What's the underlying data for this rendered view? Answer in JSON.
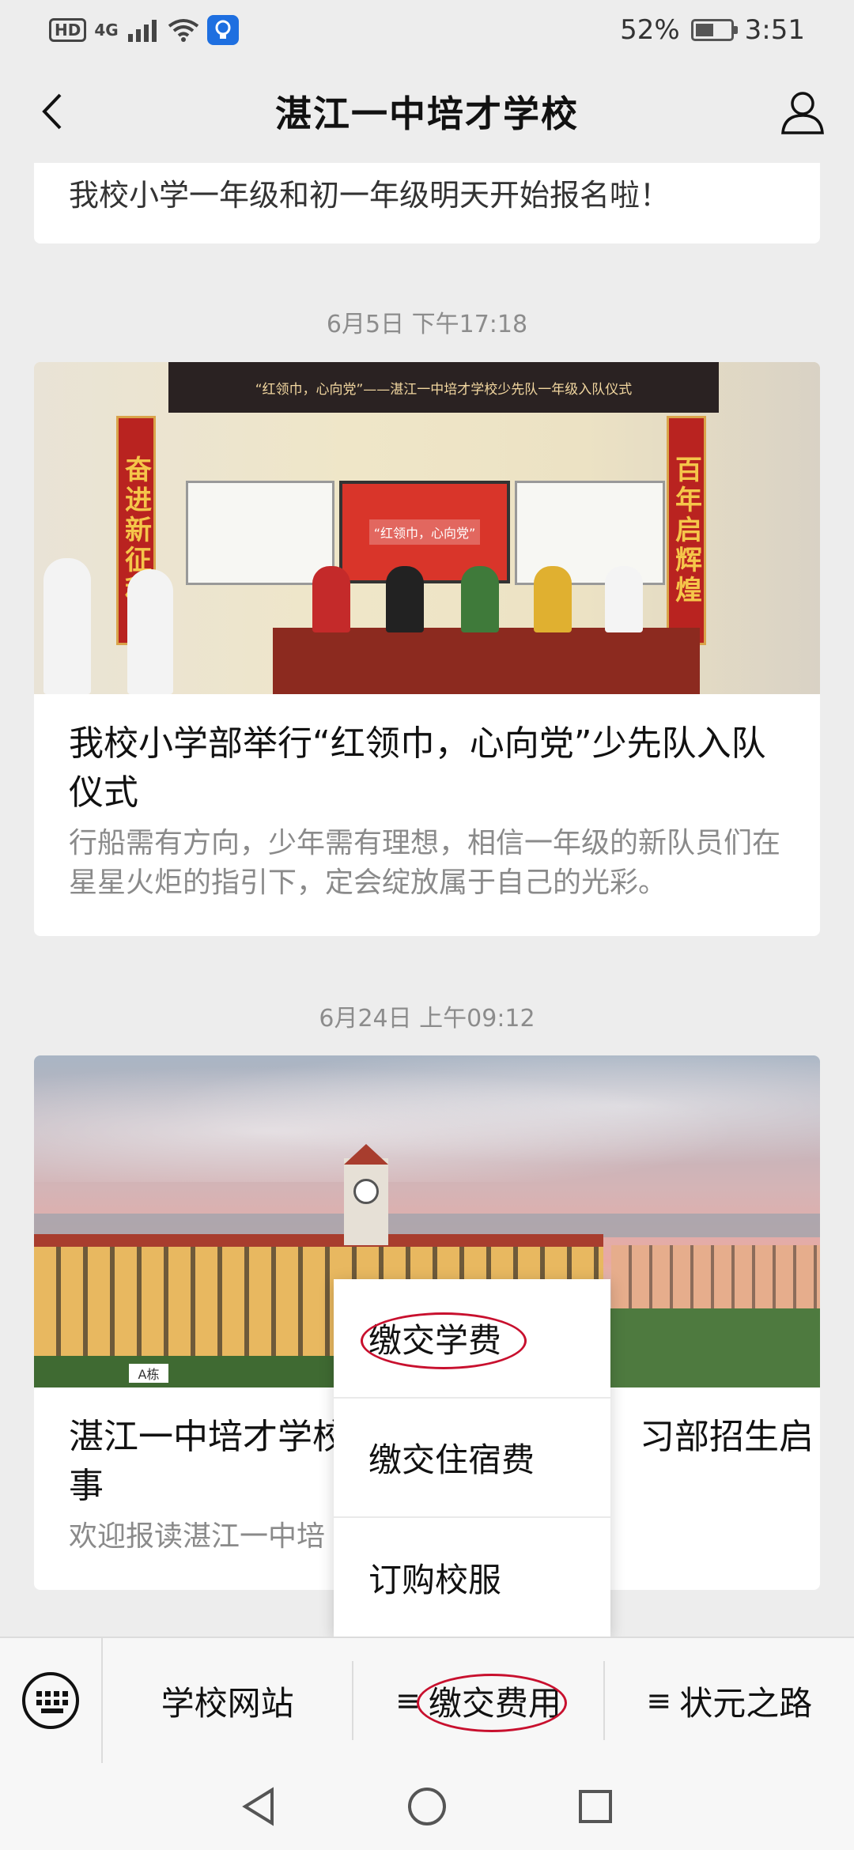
{
  "status_bar": {
    "hd": "HD",
    "network": "4G",
    "battery_percent": "52%",
    "battery_level": 0.52,
    "time": "3:51"
  },
  "nav": {
    "title": "湛江一中培才学校",
    "back_icon": "chevron-left-icon",
    "profile_icon": "user-icon"
  },
  "feed": {
    "partial_card": {
      "text": "我校小学一年级和初一年级明天开始报名啦！"
    },
    "posts": [
      {
        "timestamp": "6月5日 下午17:18",
        "banner_text": "“红领巾，心向党”——湛江一中培才学校少先队一年级入队仪式",
        "couplet_left": "奋进新征程",
        "couplet_right": "百年启辉煌",
        "screen_text": "“红领巾，心向党”",
        "title": "我校小学部举行“红领巾，心向党”少先队入队仪式",
        "desc": "行船需有方向，少年需有理想，相信一年级的新队员们在星星火炬的指引下，定会绽放属于自己的光彩。"
      },
      {
        "timestamp": "6月24日 上午09:12",
        "sign_text": "A栋",
        "title": "湛江一中培才学校",
        "title_tail": "习部招生启",
        "title_line2": "事",
        "desc": "欢迎报读湛江一中培"
      }
    ]
  },
  "popup_menu": {
    "items": [
      {
        "label": "缴交学费"
      },
      {
        "label": "缴交住宿费"
      },
      {
        "label": "订购校服"
      }
    ]
  },
  "menu_bar": {
    "keyboard_icon": "keyboard-icon",
    "items": [
      {
        "label": "学校网站"
      },
      {
        "label": "缴交费用",
        "prefix": "≡"
      },
      {
        "label": "状元之路",
        "prefix": "≡"
      }
    ]
  },
  "system_nav": {
    "back_icon": "triangle-back-icon",
    "home_icon": "circle-home-icon",
    "recent_icon": "square-recent-icon"
  },
  "colors": {
    "annotation_red": "#c8102e",
    "background": "#ededed"
  }
}
